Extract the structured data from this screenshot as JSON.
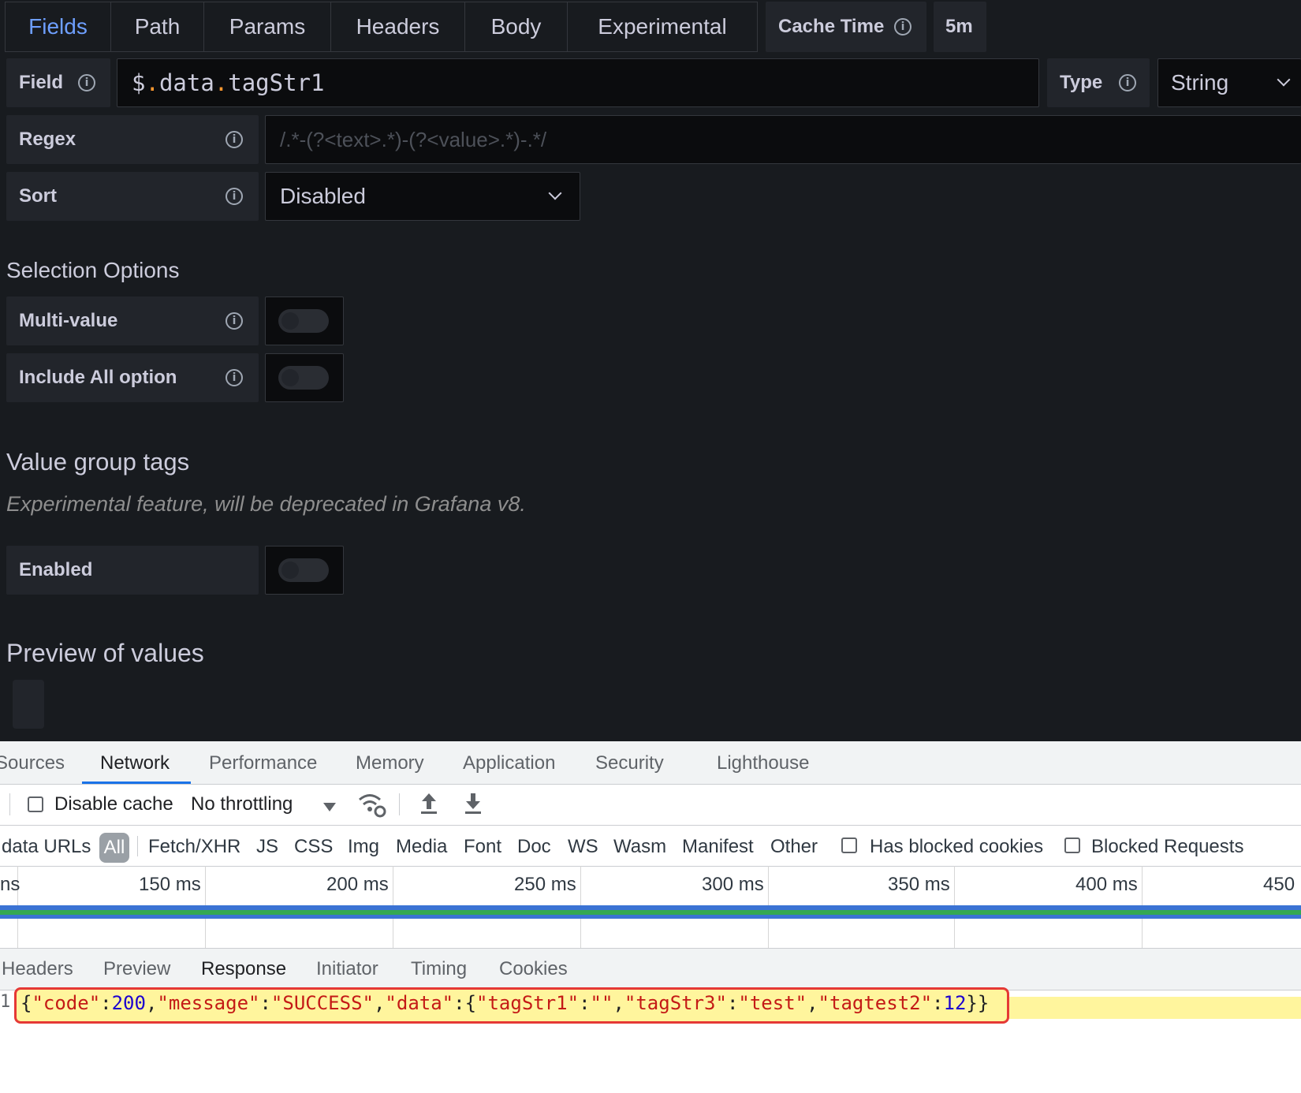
{
  "tabs": [
    "Fields",
    "Path",
    "Params",
    "Headers",
    "Body",
    "Experimental"
  ],
  "cache_time": {
    "label": "Cache Time",
    "value": "5m"
  },
  "field": {
    "label": "Field",
    "value_prefix": "$",
    "value_dot1": ".",
    "value_part1": "data",
    "value_dot2": ".",
    "value_part2": "tagStr1"
  },
  "type": {
    "label": "Type",
    "value": "String"
  },
  "regex": {
    "label": "Regex",
    "placeholder": "/.*-(?<text>.*)-(?<value>.*)-.*/"
  },
  "sort": {
    "label": "Sort",
    "value": "Disabled"
  },
  "selection_options": {
    "heading": "Selection Options",
    "multi_value": "Multi-value",
    "include_all": "Include All option"
  },
  "value_group_tags": {
    "heading": "Value group tags",
    "note": "Experimental feature, will be deprecated in Grafana v8.",
    "enabled": "Enabled"
  },
  "preview": {
    "heading": "Preview of values"
  },
  "devtools": {
    "tabs": [
      "Sources",
      "Network",
      "Performance",
      "Memory",
      "Application",
      "Security",
      "Lighthouse"
    ],
    "active_tab": "Network",
    "toolbar": {
      "disable_cache": "Disable cache",
      "throttling": "No throttling"
    },
    "filters": {
      "data_urls": "data URLs",
      "all": "All",
      "items": [
        "Fetch/XHR",
        "JS",
        "CSS",
        "Img",
        "Media",
        "Font",
        "Doc",
        "WS",
        "Wasm",
        "Manifest",
        "Other"
      ],
      "has_blocked_cookies": "Has blocked cookies",
      "blocked_requests": "Blocked Requests"
    },
    "timeline_ticks": [
      "ns",
      "150 ms",
      "200 ms",
      "250 ms",
      "300 ms",
      "350 ms",
      "400 ms",
      "450"
    ],
    "detail_tabs": [
      "Headers",
      "Preview",
      "Response",
      "Initiator",
      "Timing",
      "Cookies"
    ],
    "active_detail_tab": "Response",
    "response": {
      "line_number": "1",
      "tokens": [
        {
          "t": "p",
          "v": "{"
        },
        {
          "t": "k",
          "v": "\"code\""
        },
        {
          "t": "p",
          "v": ":"
        },
        {
          "t": "n",
          "v": "200"
        },
        {
          "t": "p",
          "v": ","
        },
        {
          "t": "k",
          "v": "\"message\""
        },
        {
          "t": "p",
          "v": ":"
        },
        {
          "t": "k",
          "v": "\"SUCCESS\""
        },
        {
          "t": "p",
          "v": ","
        },
        {
          "t": "k",
          "v": "\"data\""
        },
        {
          "t": "p",
          "v": ":{"
        },
        {
          "t": "k",
          "v": "\"tagStr1\""
        },
        {
          "t": "p",
          "v": ":"
        },
        {
          "t": "k",
          "v": "\"\""
        },
        {
          "t": "p",
          "v": ","
        },
        {
          "t": "k",
          "v": "\"tagStr3\""
        },
        {
          "t": "p",
          "v": ":"
        },
        {
          "t": "k",
          "v": "\"test\""
        },
        {
          "t": "p",
          "v": ","
        },
        {
          "t": "k",
          "v": "\"tagtest2\""
        },
        {
          "t": "p",
          "v": ":"
        },
        {
          "t": "n",
          "v": "12"
        },
        {
          "t": "p",
          "v": "}}"
        }
      ]
    }
  },
  "colors": {
    "accent": "#6e9fff",
    "panel_bg": "#181b1f",
    "highlight": "#fff59d",
    "box_border": "#e53935"
  }
}
